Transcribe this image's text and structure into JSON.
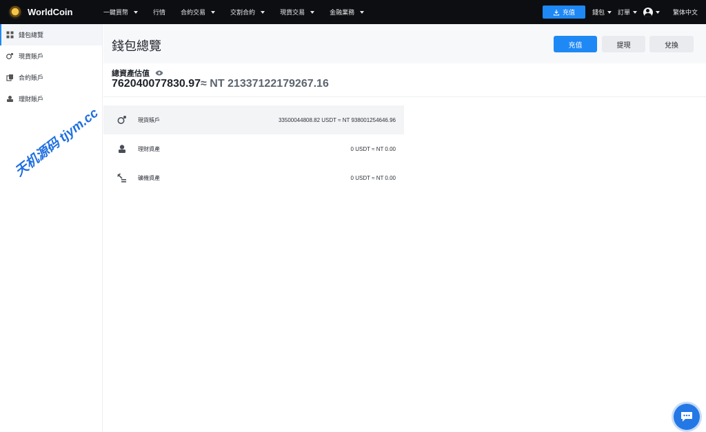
{
  "brand": {
    "name": "WorldCoin"
  },
  "nav": [
    {
      "label": "一鍵買幣",
      "caret": true
    },
    {
      "label": "行情",
      "caret": false
    },
    {
      "label": "合約交易",
      "caret": true
    },
    {
      "label": "交割合約",
      "caret": true
    },
    {
      "label": "現貨交易",
      "caret": true
    },
    {
      "label": "金融業務",
      "caret": true
    }
  ],
  "topright": {
    "deposit_label": "充值",
    "wallet_label": "錢包",
    "orders_label": "訂單",
    "language": "繁体中文"
  },
  "sidebar": {
    "items": [
      {
        "label": "錢包總覽",
        "icon": "dashboard-icon",
        "active": true
      },
      {
        "label": "現貨賬戶",
        "icon": "spot-account-icon",
        "active": false
      },
      {
        "label": "合約賬戶",
        "icon": "contract-account-icon",
        "active": false
      },
      {
        "label": "理財賬戶",
        "icon": "finance-account-icon",
        "active": false
      }
    ]
  },
  "header": {
    "title": "錢包總覽",
    "deposit_label": "充值",
    "withdraw_label": "提現",
    "exchange_label": "兌換"
  },
  "summary": {
    "label": "總資產估值",
    "usdt_value": "762040077830.97",
    "nt_value": "≈ NT 21337122179267.16"
  },
  "accounts": [
    {
      "name": "現貨賬戶",
      "value": "33500044808.82 USDT ≈ NT 938001254646.96",
      "icon": "spot-account-icon"
    },
    {
      "name": "理財資產",
      "value": "0 USDT ≈ NT 0.00",
      "icon": "finance-asset-icon"
    },
    {
      "name": "礦機資產",
      "value": "0 USDT ≈ NT 0.00",
      "icon": "mining-asset-icon"
    }
  ],
  "watermark": "天机源码 tjym.cc",
  "colors": {
    "accent": "#1e88f5",
    "topbar": "#0c0e12"
  }
}
